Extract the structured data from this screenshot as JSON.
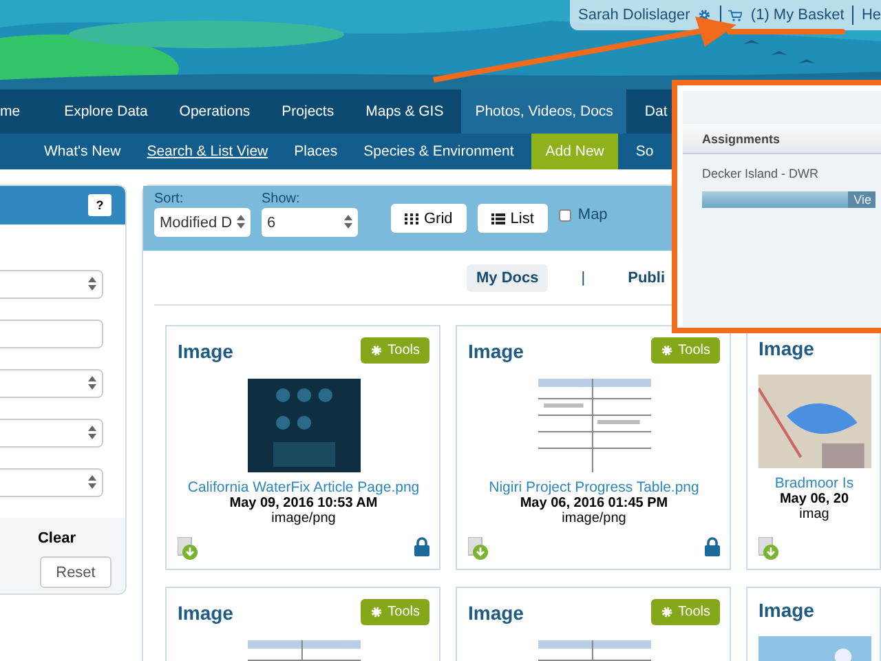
{
  "user_bar": {
    "user_name": "Sarah Dolislager",
    "basket_label": "(1) My Basket",
    "help_label": "He"
  },
  "nav": {
    "items": [
      {
        "label": "me",
        "selected": false
      },
      {
        "label": "Explore Data",
        "selected": false
      },
      {
        "label": "Operations",
        "selected": false
      },
      {
        "label": "Projects",
        "selected": false
      },
      {
        "label": "Maps & GIS",
        "selected": false
      },
      {
        "label": "Photos, Videos, Docs",
        "selected": true
      },
      {
        "label": "Dat",
        "selected": false
      }
    ]
  },
  "subnav": {
    "items": [
      {
        "label": "What's New",
        "selected": false,
        "kind": "link"
      },
      {
        "label": "Search & List View",
        "selected": true,
        "kind": "link"
      },
      {
        "label": "Places",
        "selected": false,
        "kind": "link"
      },
      {
        "label": "Species & Environment",
        "selected": false,
        "kind": "link"
      },
      {
        "label": "Add New",
        "selected": false,
        "kind": "button"
      },
      {
        "label": "So",
        "selected": false,
        "kind": "link"
      }
    ]
  },
  "filter_panel": {
    "help_button": "?",
    "fields": [
      {
        "kind": "select"
      },
      {
        "kind": "text"
      },
      {
        "kind": "select"
      },
      {
        "kind": "select"
      },
      {
        "kind": "select"
      }
    ],
    "clear_label": "Clear",
    "reset_button": "Reset"
  },
  "toolbar": {
    "sort_label": "Sort:",
    "sort_value": "Modified D",
    "show_label": "Show:",
    "show_value": "6",
    "view_buttons": [
      {
        "label": "Grid",
        "kind": "grid"
      },
      {
        "label": "List",
        "kind": "list"
      }
    ],
    "map_checkbox": {
      "label": "Map",
      "checked": false
    }
  },
  "doc_tabs": {
    "separator": "|",
    "items": [
      {
        "label": "My Docs",
        "selected": true
      },
      {
        "label": "Publi",
        "selected": false
      }
    ]
  },
  "cards": [
    {
      "type_label": "Image",
      "tools_label": "Tools",
      "title": "California WaterFix Article Page.png",
      "date": "May 09, 2016 10:53 AM",
      "mime": "image/png",
      "locked": true
    },
    {
      "type_label": "Image",
      "tools_label": "Tools",
      "title": "Nigiri Project Progress Table.png",
      "date": "May 06, 2016 01:45 PM",
      "mime": "image/png",
      "locked": true
    },
    {
      "type_label": "Image",
      "title": "Bradmoor Is",
      "date": "May 06, 20",
      "mime": "imag"
    },
    {
      "type_label": "Image",
      "tools_label": "Tools"
    },
    {
      "type_label": "Image",
      "tools_label": "Tools"
    },
    {
      "type_label": "Image"
    }
  ],
  "popup": {
    "heading": "Assignments",
    "item": "Decker Island - DWR",
    "action": "Vie"
  }
}
